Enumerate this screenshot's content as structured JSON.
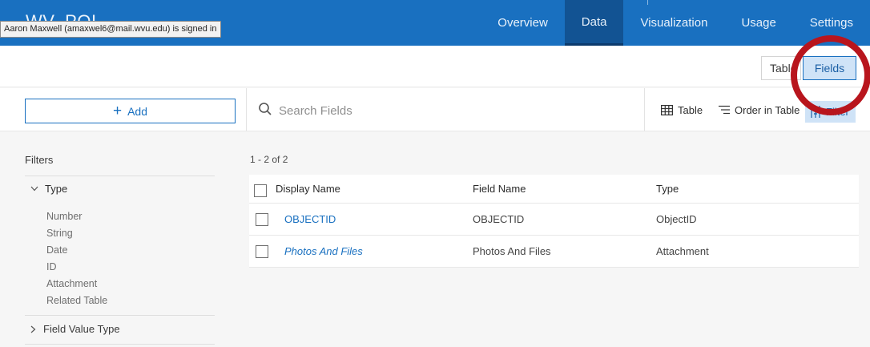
{
  "header": {
    "app_title": "WV_POI",
    "signed_in_tooltip": "Aaron Maxwell (amaxwel6@mail.wvu.edu) is signed in",
    "nav": [
      {
        "label": "Overview",
        "active": false
      },
      {
        "label": "Data",
        "active": true
      },
      {
        "label": "Visualization",
        "active": false
      },
      {
        "label": "Usage",
        "active": false
      },
      {
        "label": "Settings",
        "active": false
      }
    ]
  },
  "view_toggle": {
    "table_label": "Table",
    "fields_label": "Fields",
    "selected": "Fields"
  },
  "toolbar": {
    "add_label": "Add",
    "search_placeholder": "Search Fields",
    "table_label": "Table",
    "order_label": "Order in Table",
    "filter_label": "Filter"
  },
  "filters": {
    "title": "Filters",
    "type_section": {
      "label": "Type",
      "expanded": true,
      "options": [
        "Number",
        "String",
        "Date",
        "ID",
        "Attachment",
        "Related Table"
      ]
    },
    "field_value_type_section": {
      "label": "Field Value Type",
      "expanded": false
    }
  },
  "table": {
    "count_text": "1 - 2 of 2",
    "columns": [
      "Display Name",
      "Field Name",
      "Type"
    ],
    "rows": [
      {
        "display_name": "OBJECTID",
        "field_name": "OBJECTID",
        "type": "ObjectID",
        "italic": false
      },
      {
        "display_name": "Photos And Files",
        "field_name": "Photos And Files",
        "type": "Attachment",
        "italic": true
      }
    ]
  },
  "colors": {
    "header_blue": "#1970c0",
    "active_tab": "#125393",
    "annotation_ring": "#b8151d",
    "selected_bg": "#cfe3f7"
  }
}
